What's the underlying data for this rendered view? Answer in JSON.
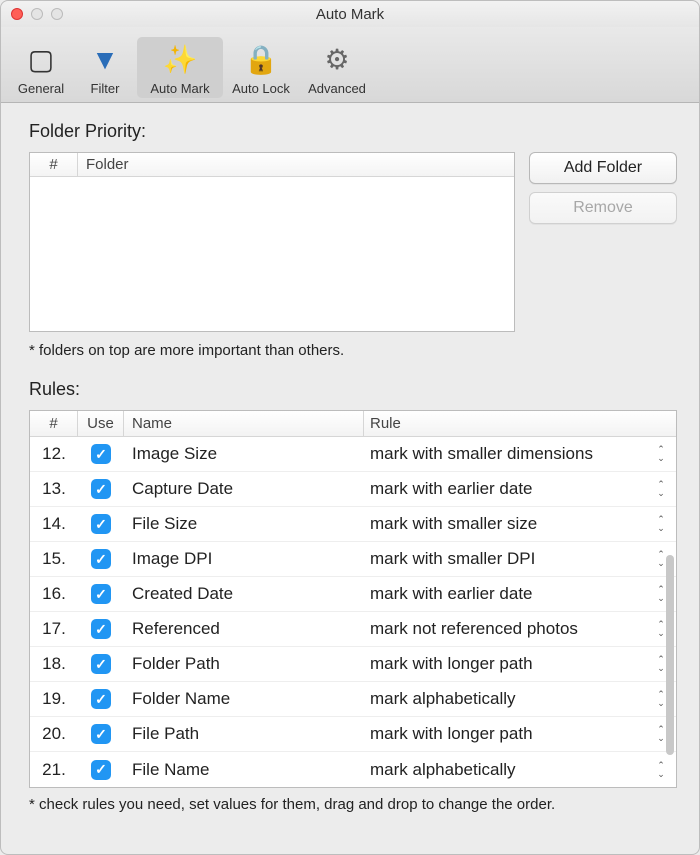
{
  "window": {
    "title": "Auto Mark"
  },
  "toolbar": {
    "items": [
      {
        "label": "General",
        "icon": "▢"
      },
      {
        "label": "Filter",
        "icon": "▼"
      },
      {
        "label": "Auto Mark",
        "icon": "✨"
      },
      {
        "label": "Auto Lock",
        "icon": "🔒"
      },
      {
        "label": "Advanced",
        "icon": "⚙"
      }
    ],
    "selected_index": 2
  },
  "folder_priority": {
    "label": "Folder Priority:",
    "columns": {
      "num": "#",
      "folder": "Folder"
    },
    "rows": [],
    "buttons": {
      "add": "Add Folder",
      "remove": "Remove"
    },
    "remove_enabled": false,
    "hint": "* folders on top are more important than others."
  },
  "rules": {
    "label": "Rules:",
    "columns": {
      "num": "#",
      "use": "Use",
      "name": "Name",
      "rule": "Rule"
    },
    "rows": [
      {
        "num": "12.",
        "use": true,
        "name": "Image Size",
        "rule": "mark with smaller dimensions"
      },
      {
        "num": "13.",
        "use": true,
        "name": "Capture Date",
        "rule": "mark with earlier date"
      },
      {
        "num": "14.",
        "use": true,
        "name": "File Size",
        "rule": "mark with smaller size"
      },
      {
        "num": "15.",
        "use": true,
        "name": "Image DPI",
        "rule": "mark with smaller DPI"
      },
      {
        "num": "16.",
        "use": true,
        "name": "Created Date",
        "rule": "mark with earlier date"
      },
      {
        "num": "17.",
        "use": true,
        "name": "Referenced",
        "rule": "mark not referenced photos"
      },
      {
        "num": "18.",
        "use": true,
        "name": "Folder Path",
        "rule": "mark with longer path"
      },
      {
        "num": "19.",
        "use": true,
        "name": "Folder Name",
        "rule": "mark alphabetically"
      },
      {
        "num": "20.",
        "use": true,
        "name": "File Path",
        "rule": "mark with longer path"
      },
      {
        "num": "21.",
        "use": true,
        "name": "File Name",
        "rule": "mark alphabetically"
      }
    ],
    "hint": "* check rules you need, set values for them, drag and drop to change the order."
  }
}
